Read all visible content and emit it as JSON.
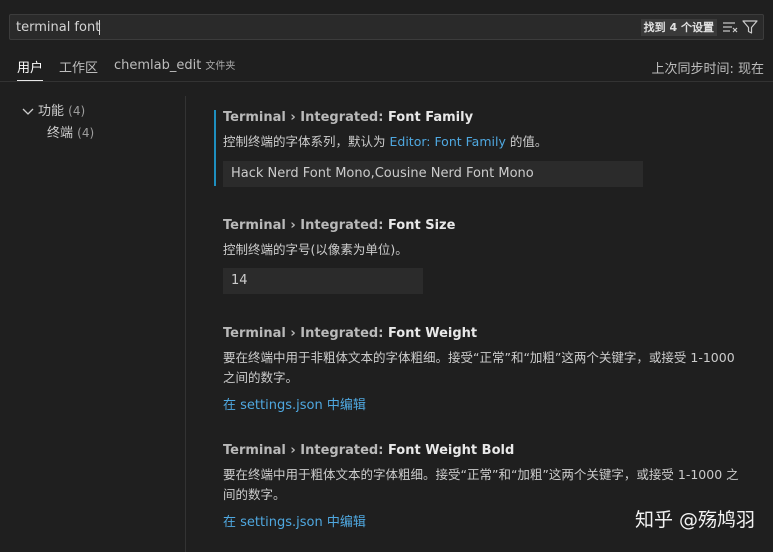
{
  "search": {
    "value": "terminal font",
    "result_count": "找到 4 个设置"
  },
  "tabs": [
    {
      "label": "用户",
      "active": true
    },
    {
      "label": "工作区",
      "active": false
    },
    {
      "label": "chemlab_edit",
      "sub": "文件夹",
      "active": false
    }
  ],
  "sync_status": "上次同步时间: 现在",
  "toc": {
    "features": {
      "label": "功能",
      "count": "(4)"
    },
    "terminal": {
      "label": "终端",
      "count": "(4)"
    }
  },
  "settings": [
    {
      "category": "Terminal › Integrated: ",
      "name": "Font Family",
      "desc_before": "控制终端的字体系列，默认为 ",
      "desc_link": "Editor: Font Family",
      "desc_after": " 的值。",
      "value": "Hack Nerd Font Mono,Cousine Nerd Font Mono"
    },
    {
      "category": "Terminal › Integrated: ",
      "name": "Font Size",
      "desc": "控制终端的字号(以像素为单位)。",
      "value": "14"
    },
    {
      "category": "Terminal › Integrated: ",
      "name": "Font Weight",
      "desc": "要在终端中用于非粗体文本的字体粗细。接受“正常”和“加粗”这两个关键字，或接受 1-1000 之间的数字。",
      "edit_link": "在 settings.json 中编辑"
    },
    {
      "category": "Terminal › Integrated: ",
      "name": "Font Weight Bold",
      "desc": "要在终端中用于粗体文本的字体粗细。接受“正常”和“加粗”这两个关键字，或接受 1-1000 之间的数字。",
      "edit_link": "在 settings.json 中编辑"
    }
  ],
  "watermark": "知乎 @殇鸠羽",
  "colors": {
    "background": "#1f1f1f",
    "accent_link": "#4fa8e0",
    "focus_bar": "#1e8fbf"
  }
}
